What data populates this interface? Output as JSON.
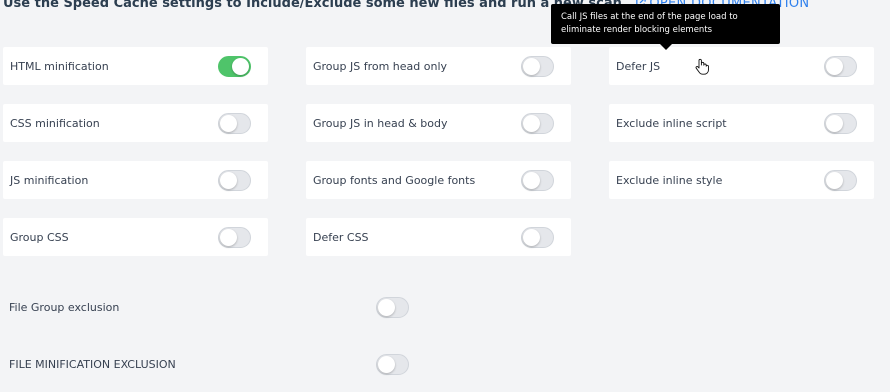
{
  "intro": {
    "text": "Use the Speed Cache settings to Include/Exclude some new files and run a new scan.",
    "doc_link": "OPEN DOCUMENTATION"
  },
  "settings": [
    {
      "label": "HTML minification",
      "on": true
    },
    {
      "label": "Group JS from head only",
      "on": false
    },
    {
      "label": "Defer JS",
      "on": false
    },
    {
      "label": "CSS minification",
      "on": false
    },
    {
      "label": "Group JS in head & body",
      "on": false
    },
    {
      "label": "Exclude inline script",
      "on": false
    },
    {
      "label": "JS minification",
      "on": false
    },
    {
      "label": "Group fonts and Google fonts",
      "on": false
    },
    {
      "label": "Exclude inline style",
      "on": false
    },
    {
      "label": "Group CSS",
      "on": false
    },
    {
      "label": "Defer CSS",
      "on": false
    }
  ],
  "exclusions": [
    {
      "label": "File Group exclusion",
      "on": false
    },
    {
      "label": "FILE MINIFICATION EXCLUSION",
      "on": false
    }
  ],
  "tooltip": {
    "text": "Call JS files at the end of the page load to eliminate render blocking elements"
  },
  "colors": {
    "toggle_on": "#4fc46a",
    "link": "#2f80ed",
    "tooltip_bg": "#000000"
  }
}
